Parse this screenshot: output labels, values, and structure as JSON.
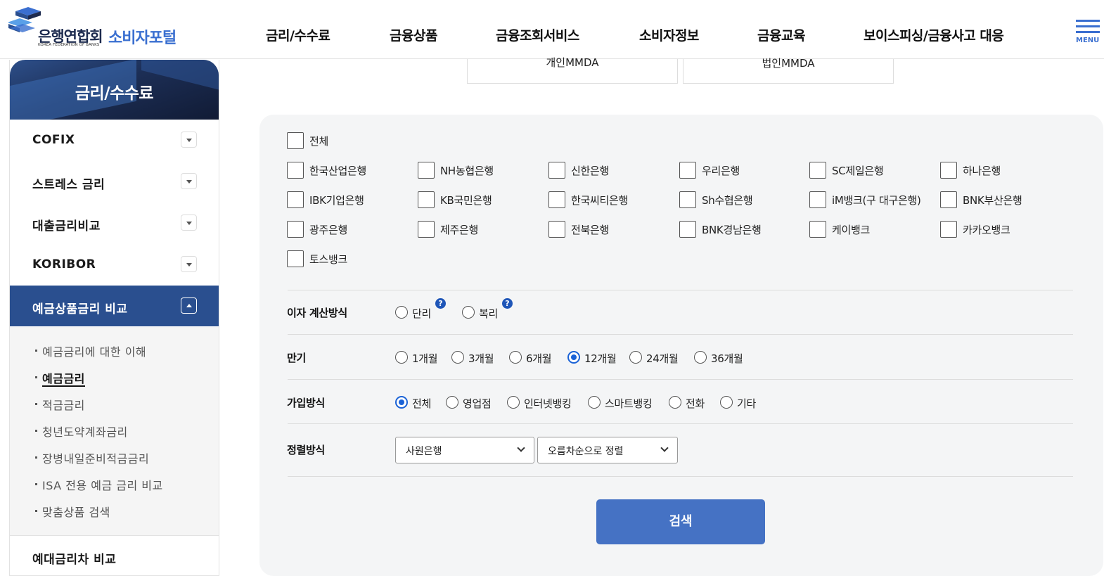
{
  "header": {
    "logo_main": "은행연합회",
    "logo_sub": "KOREA FEDERATION OF BANKS",
    "logo_portal": "소비자포털",
    "nav": [
      "금리/수수료",
      "금융상품",
      "금융조회서비스",
      "소비자정보",
      "금융교육",
      "보이스피싱/금융사고 대응"
    ],
    "menu_label": "MENU"
  },
  "sidebar": {
    "title": "금리/수수료",
    "items": [
      "COFIX",
      "스트레스 금리",
      "대출금리비교",
      "KORIBOR"
    ],
    "active_item": "예금상품금리 비교",
    "sub_items": [
      "예금금리에 대한 이해",
      "예금금리",
      "적금금리",
      "청년도약계좌금리",
      "장병내일준비적금금리",
      "ISA 전용 예금 금리 비교",
      "맞춤상품 검색"
    ],
    "current_sub": "예금금리",
    "last_item": "예대금리차 비교"
  },
  "tabs": [
    "개인MMDA",
    "법인MMDA"
  ],
  "banks": {
    "all_label": "전체",
    "list": [
      "한국산업은행",
      "NH농협은행",
      "신한은행",
      "우리은행",
      "SC제일은행",
      "하나은행",
      "IBK기업은행",
      "KB국민은행",
      "한국씨티은행",
      "Sh수협은행",
      "iM뱅크(구 대구은행)",
      "BNK부산은행",
      "광주은행",
      "제주은행",
      "전북은행",
      "BNK경남은행",
      "케이뱅크",
      "카카오뱅크",
      "토스뱅크"
    ]
  },
  "interest": {
    "label": "이자 계산방식",
    "options": [
      "단리",
      "복리"
    ],
    "help": "?"
  },
  "term": {
    "label": "만기",
    "options": [
      "1개월",
      "3개월",
      "6개월",
      "12개월",
      "24개월",
      "36개월"
    ],
    "selected": "12개월"
  },
  "join": {
    "label": "가입방식",
    "options": [
      "전체",
      "영업점",
      "인터넷뱅킹",
      "스마트뱅킹",
      "전화",
      "기타"
    ],
    "selected": "전체"
  },
  "sort": {
    "label": "정렬방식",
    "select1": "사원은행",
    "select2": "오름차순으로 정렬"
  },
  "search_label": "검색",
  "colors": {
    "primary": "#4572c4",
    "sidebar_active": "#2a4f8f",
    "radio_on": "#1a62d6"
  }
}
